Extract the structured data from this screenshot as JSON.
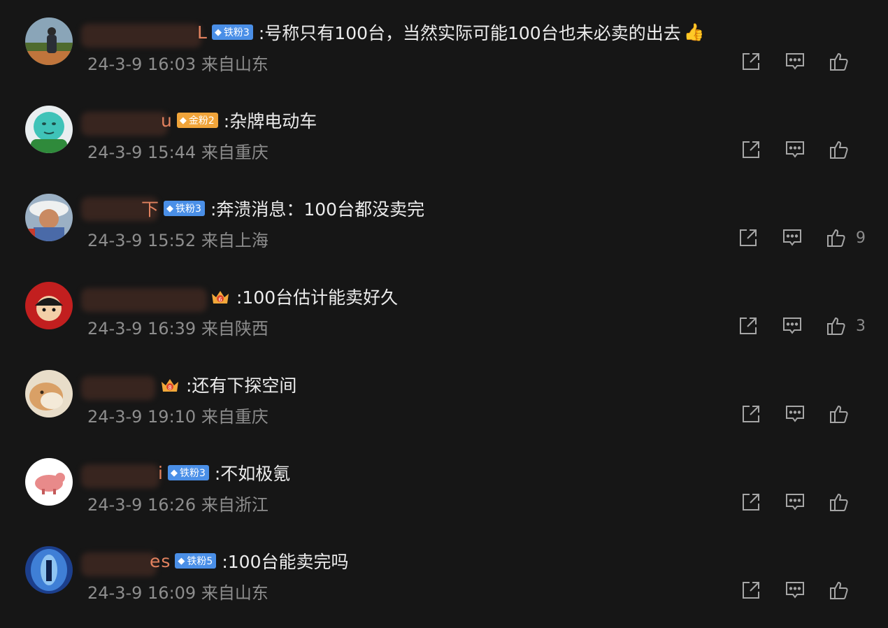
{
  "comments": [
    {
      "username_visible": "L",
      "badge": {
        "kind": "iron",
        "label": "铁粉3"
      },
      "text": ":号称只有100台，当然实际可能100台也未必卖的出去",
      "emoji": "👍",
      "time": "24-3-9 16:03",
      "location": "来自山东",
      "likes": "",
      "avatar": "photo-person"
    },
    {
      "username_visible": "u",
      "badge": {
        "kind": "gold",
        "label": "金粉2"
      },
      "text": ":杂牌电动车",
      "time": "24-3-9 15:44",
      "location": "来自重庆",
      "likes": "",
      "avatar": "green-cartoon"
    },
    {
      "username_visible": "下",
      "badge": {
        "kind": "iron",
        "label": "铁粉3"
      },
      "text": ":奔溃消息：100台都没卖完",
      "time": "24-3-9 15:52",
      "location": "来自上海",
      "likes": "9",
      "avatar": "photo-hat"
    },
    {
      "username_visible": "",
      "crown": {
        "level": "6"
      },
      "text": ":100台估计能卖好久",
      "time": "24-3-9 16:39",
      "location": "来自陕西",
      "likes": "3",
      "avatar": "red-hood-cartoon"
    },
    {
      "username_visible": "",
      "crown": {
        "level": "8"
      },
      "text": ":还有下探空间",
      "time": "24-3-9 19:10",
      "location": "来自重庆",
      "likes": "",
      "avatar": "cat-photo"
    },
    {
      "username_visible": "i",
      "badge": {
        "kind": "iron",
        "label": "铁粉3"
      },
      "text": ":不如极氪",
      "time": "24-3-9 16:26",
      "location": "来自浙江",
      "likes": "",
      "avatar": "pig-cartoon"
    },
    {
      "username_visible": "es",
      "badge": {
        "kind": "iron",
        "label": "铁粉5"
      },
      "text": ":100台能卖完吗",
      "time": "24-3-9 16:09",
      "location": "来自山东",
      "likes": "",
      "avatar": "blue-photo"
    }
  ],
  "icons": {
    "share": "share-icon",
    "reply": "comment-icon",
    "like": "thumbs-up-icon",
    "badge_gem": "diamond-icon",
    "crown": "crown-icon"
  },
  "colors": {
    "background": "#161616",
    "username": "#e2825f",
    "meta": "#8d8d8d",
    "iron_badge": "#4a8fe7",
    "gold_badge": "#f0a43a"
  }
}
